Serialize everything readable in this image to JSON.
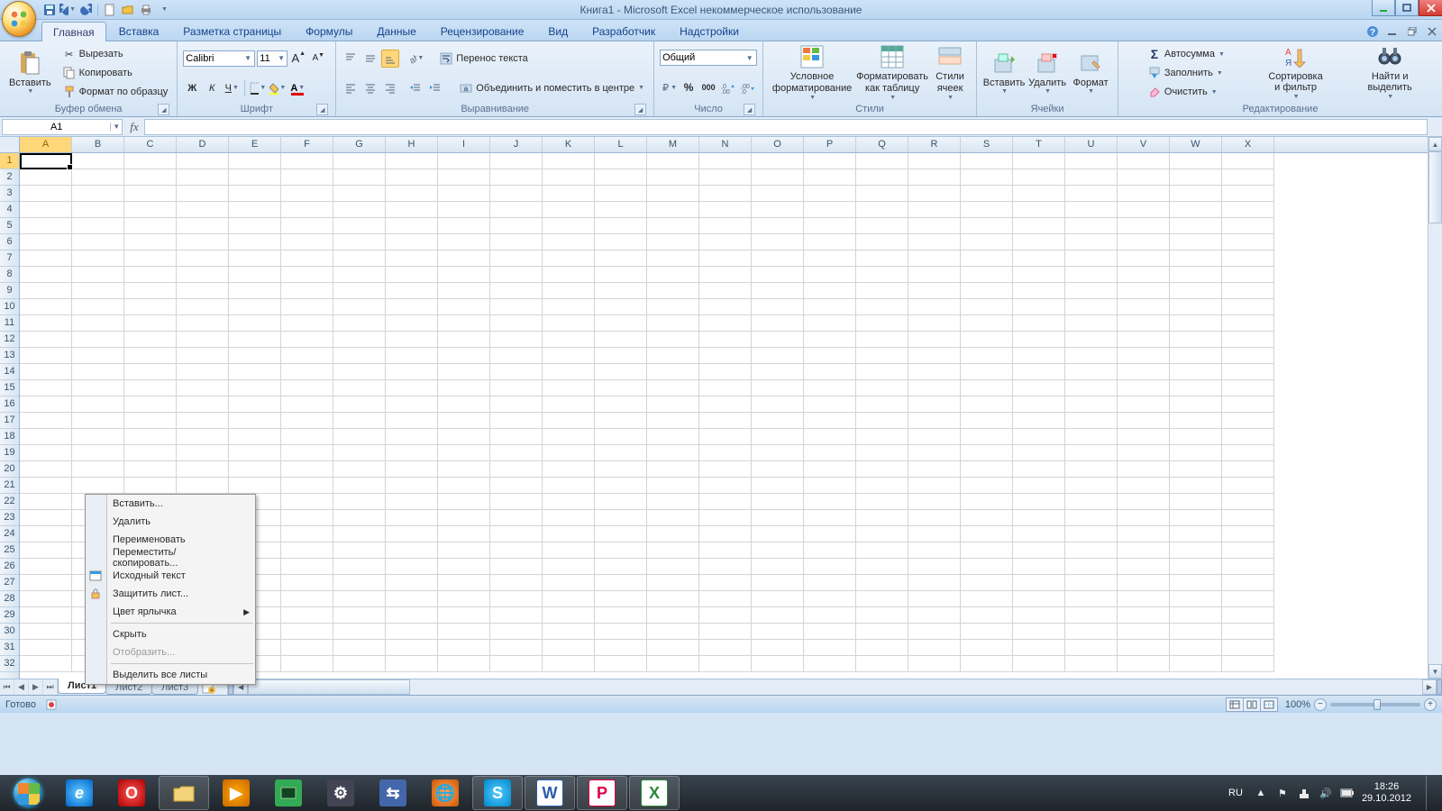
{
  "title": "Книга1 - Microsoft Excel некоммерческое использование",
  "qat": {
    "save": "save",
    "undo": "undo",
    "redo": "redo",
    "new": "new",
    "open": "open",
    "quickprint": "quickprint"
  },
  "tabs": {
    "home": "Главная",
    "insert": "Вставка",
    "pagelayout": "Разметка страницы",
    "formulas": "Формулы",
    "data": "Данные",
    "review": "Рецензирование",
    "view": "Вид",
    "developer": "Разработчик",
    "addins": "Надстройки"
  },
  "clipboard": {
    "group": "Буфер обмена",
    "paste": "Вставить",
    "cut": "Вырезать",
    "copy": "Копировать",
    "formatpainter": "Формат по образцу"
  },
  "font": {
    "group": "Шрифт",
    "name": "Calibri",
    "size": "11"
  },
  "alignment": {
    "group": "Выравнивание",
    "wrap": "Перенос текста",
    "merge": "Объединить и поместить в центре"
  },
  "number": {
    "group": "Число",
    "format": "Общий"
  },
  "styles": {
    "group": "Стили",
    "conditional": "Условное форматирование",
    "astable": "Форматировать как таблицу",
    "cellstyles": "Стили ячеек"
  },
  "cells": {
    "group": "Ячейки",
    "insert": "Вставить",
    "delete": "Удалить",
    "format": "Формат"
  },
  "editing": {
    "group": "Редактирование",
    "autosum": "Автосумма",
    "fill": "Заполнить",
    "clear": "Очистить",
    "sort": "Сортировка и фильтр",
    "find": "Найти и выделить"
  },
  "namebox": "A1",
  "columns": [
    "A",
    "B",
    "C",
    "D",
    "E",
    "F",
    "G",
    "H",
    "I",
    "J",
    "K",
    "L",
    "M",
    "N",
    "O",
    "P",
    "Q",
    "R",
    "S",
    "T",
    "U",
    "V",
    "W",
    "X"
  ],
  "sheets": {
    "s1": "Лист1",
    "s2": "Лист2",
    "s3": "Лист3"
  },
  "status": {
    "ready": "Готово",
    "zoom": "100%"
  },
  "context": {
    "insert": "Вставить...",
    "delete": "Удалить",
    "rename": "Переименовать",
    "move": "Переместить/скопировать...",
    "viewcode": "Исходный текст",
    "protect": "Защитить лист...",
    "tabcolor": "Цвет ярлычка",
    "hide": "Скрыть",
    "unhide": "Отобразить...",
    "selectall": "Выделить все листы"
  },
  "tray": {
    "lang": "RU",
    "time": "18:26",
    "date": "29.10.2012"
  }
}
